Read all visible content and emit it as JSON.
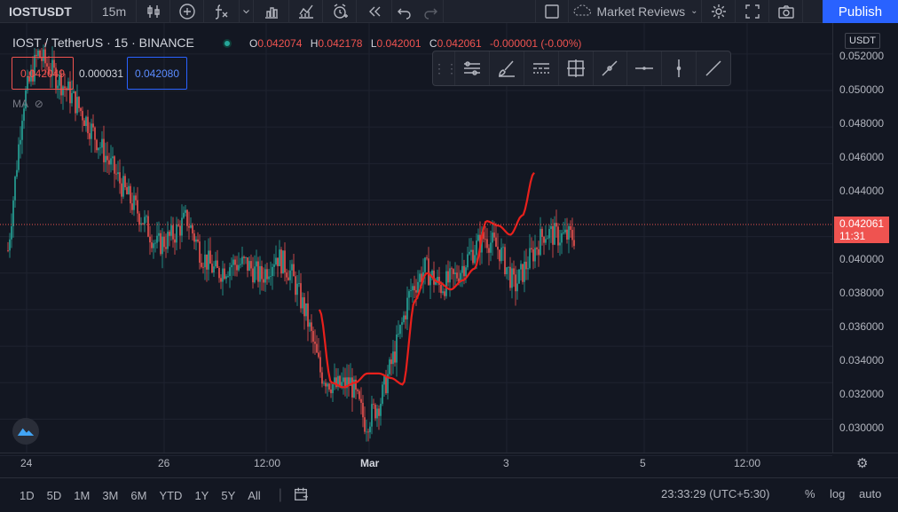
{
  "topbar": {
    "symbol": "IOSTUSDT",
    "interval": "15m",
    "market_reviews": "Market Reviews",
    "publish": "Publish"
  },
  "legend": {
    "title": "IOST / TetherUS · 15 · BINANCE",
    "o_label": "O",
    "o": "0.042074",
    "h_label": "H",
    "h": "0.042178",
    "l_label": "L",
    "l": "0.042001",
    "c_label": "C",
    "c": "0.042061",
    "change": "-0.000001 (-0.00%)",
    "bid": "0.042049",
    "spread": "0.000031",
    "ask": "0.042080",
    "ma": "MA"
  },
  "price_scale": {
    "unit": "USDT",
    "labels": [
      "0.052000",
      "0.050000",
      "0.048000",
      "0.046000",
      "0.044000",
      "0.040000",
      "0.038000",
      "0.036000",
      "0.034000",
      "0.032000",
      "0.030000"
    ],
    "last_price": "0.042061",
    "countdown": "11:31"
  },
  "time_axis": [
    "24",
    "26",
    "12:00",
    "Mar",
    "3",
    "5",
    "12:00"
  ],
  "bottom": {
    "ranges": [
      "1D",
      "5D",
      "1M",
      "3M",
      "6M",
      "YTD",
      "1Y",
      "5Y",
      "All"
    ],
    "clock": "23:33:29 (UTC+5:30)",
    "percent": "%",
    "log": "log",
    "auto": "auto"
  },
  "colors": {
    "up": "#26a69a",
    "down": "#ef5350",
    "accent": "#2962ff",
    "drawing": "#e8201c"
  },
  "chart_data": {
    "type": "candlestick",
    "price_path": [
      [
        0.0405,
        0.042
      ],
      [
        0.0465,
        0.052
      ],
      [
        0.0515,
        0.0525
      ],
      [
        0.0505,
        0.0515
      ],
      [
        0.0495,
        0.0505
      ],
      [
        0.0485,
        0.049
      ],
      [
        0.047,
        0.0475
      ],
      [
        0.0455,
        0.046
      ],
      [
        0.044,
        0.0445
      ],
      [
        0.0425,
        0.0435
      ],
      [
        0.0415,
        0.0415
      ],
      [
        0.0415,
        0.0425
      ],
      [
        0.0425,
        0.0435
      ],
      [
        0.0405,
        0.0415
      ],
      [
        0.0395,
        0.0405
      ],
      [
        0.04,
        0.041
      ],
      [
        0.0405,
        0.0405
      ],
      [
        0.0395,
        0.04
      ],
      [
        0.0405,
        0.0415
      ],
      [
        0.0395,
        0.0405
      ],
      [
        0.0375,
        0.038
      ],
      [
        0.035,
        0.034
      ],
      [
        0.034,
        0.0335
      ],
      [
        0.0345,
        0.0335
      ],
      [
        0.032,
        0.0315
      ],
      [
        0.0325,
        0.0335
      ],
      [
        0.035,
        0.0365
      ],
      [
        0.0385,
        0.0395
      ],
      [
        0.04,
        0.0405
      ],
      [
        0.0395,
        0.039
      ],
      [
        0.04,
        0.0395
      ],
      [
        0.0415,
        0.0405
      ],
      [
        0.0425,
        0.0415
      ],
      [
        0.042,
        0.0405
      ],
      [
        0.039,
        0.0395
      ],
      [
        0.04,
        0.0415
      ],
      [
        0.0425,
        0.042
      ],
      [
        0.0425,
        0.0415
      ],
      [
        0.042,
        0.042
      ]
    ],
    "ylim": [
      0.0292,
      0.0535
    ],
    "drawing_path": [
      [
        0.0385,
        0.0375
      ],
      [
        0.0345,
        0.0335
      ],
      [
        0.0345,
        0.033
      ],
      [
        0.0345,
        0.0335
      ],
      [
        0.035,
        0.034
      ],
      [
        0.035,
        0.034
      ],
      [
        0.034,
        0.0345
      ],
      [
        0.0338,
        0.034
      ],
      [
        0.037,
        0.04
      ],
      [
        0.0395,
        0.0405
      ],
      [
        0.0395,
        0.0395
      ],
      [
        0.039,
        0.0392
      ],
      [
        0.0392,
        0.04
      ],
      [
        0.0395,
        0.041
      ],
      [
        0.0425,
        0.0432
      ],
      [
        0.0427,
        0.0425
      ],
      [
        0.042,
        0.0422
      ],
      [
        0.043,
        0.0433
      ],
      [
        0.0445,
        0.0465
      ]
    ]
  }
}
